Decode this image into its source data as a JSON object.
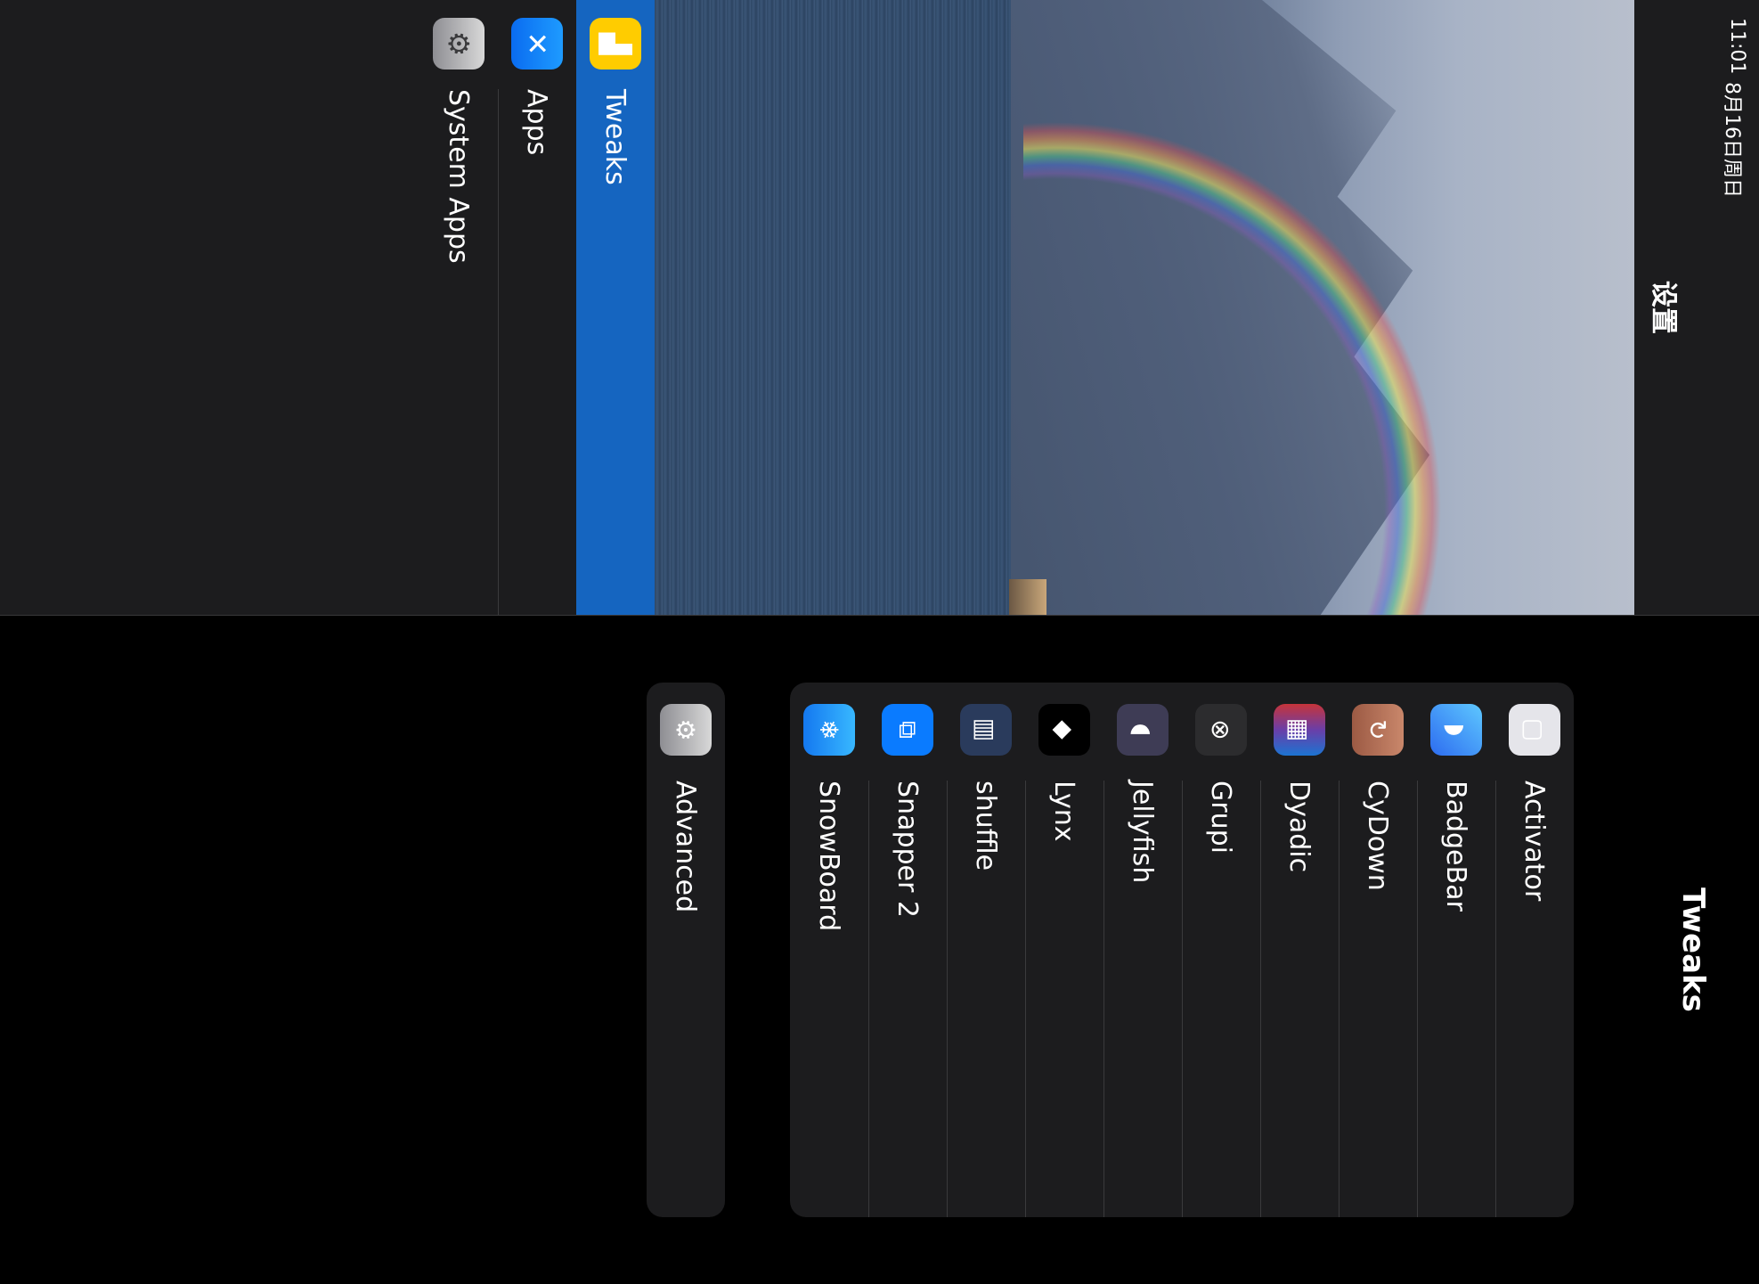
{
  "status_bar": {
    "time": "11:01",
    "date": "8月16日周日"
  },
  "master": {
    "title": "设置",
    "sidebar": [
      {
        "label": "Tweaks",
        "icon": "tweaks-icon",
        "selected": true
      },
      {
        "label": "Apps",
        "icon": "app-store-icon",
        "selected": false
      },
      {
        "label": "System Apps",
        "icon": "settings-gear-icon",
        "selected": false
      }
    ]
  },
  "detail": {
    "title": "Tweaks",
    "tweaks": [
      {
        "label": "Activator",
        "icon": "activator-icon"
      },
      {
        "label": "BadgeBar",
        "icon": "badgebar-icon"
      },
      {
        "label": "CyDown",
        "icon": "cydown-icon"
      },
      {
        "label": "Dyadic",
        "icon": "dyadic-icon"
      },
      {
        "label": "Grupi",
        "icon": "grupi-icon"
      },
      {
        "label": "Jellyfish",
        "icon": "jellyfish-icon"
      },
      {
        "label": "Lynx",
        "icon": "lynx-icon"
      },
      {
        "label": "shuffle",
        "icon": "shuffle-icon"
      },
      {
        "label": "Snapper 2",
        "icon": "snapper-icon"
      },
      {
        "label": "SnowBoard",
        "icon": "snowboard-icon"
      }
    ],
    "advanced": {
      "label": "Advanced",
      "icon": "settings-gear-icon"
    }
  },
  "colors": {
    "accent": "#1565c0",
    "background": "#000000",
    "cell": "#1c1c1e"
  }
}
